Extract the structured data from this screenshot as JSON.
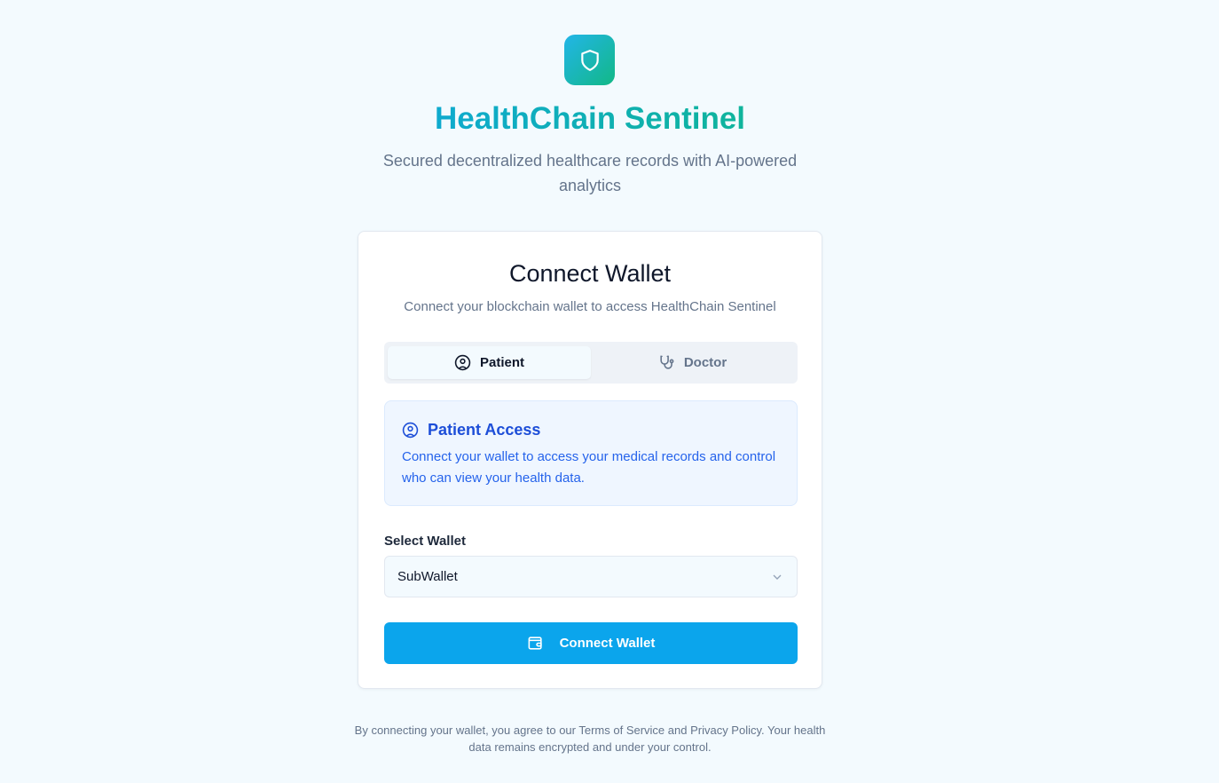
{
  "header": {
    "title": "HealthChain Sentinel",
    "subtitle": "Secured decentralized healthcare records with AI-powered analytics"
  },
  "card": {
    "title": "Connect Wallet",
    "description": "Connect your blockchain wallet to access HealthChain Sentinel",
    "tabs": [
      {
        "label": "Patient",
        "icon": "user-circle-icon",
        "active": true
      },
      {
        "label": "Doctor",
        "icon": "stethoscope-icon",
        "active": false
      }
    ],
    "info": {
      "title": "Patient Access",
      "text": "Connect your wallet to access your medical records and control who can view your health data."
    },
    "wallet_label": "Select Wallet",
    "wallet_value": "SubWallet",
    "connect_label": "Connect Wallet"
  },
  "footer": "By connecting your wallet, you agree to our Terms of Service and Privacy Policy. Your health data remains encrypted and under your control.",
  "colors": {
    "brand_start": "#0ea5e9",
    "brand_end": "#10b981",
    "button": "#0ba5ec",
    "info_text": "#2563eb"
  }
}
